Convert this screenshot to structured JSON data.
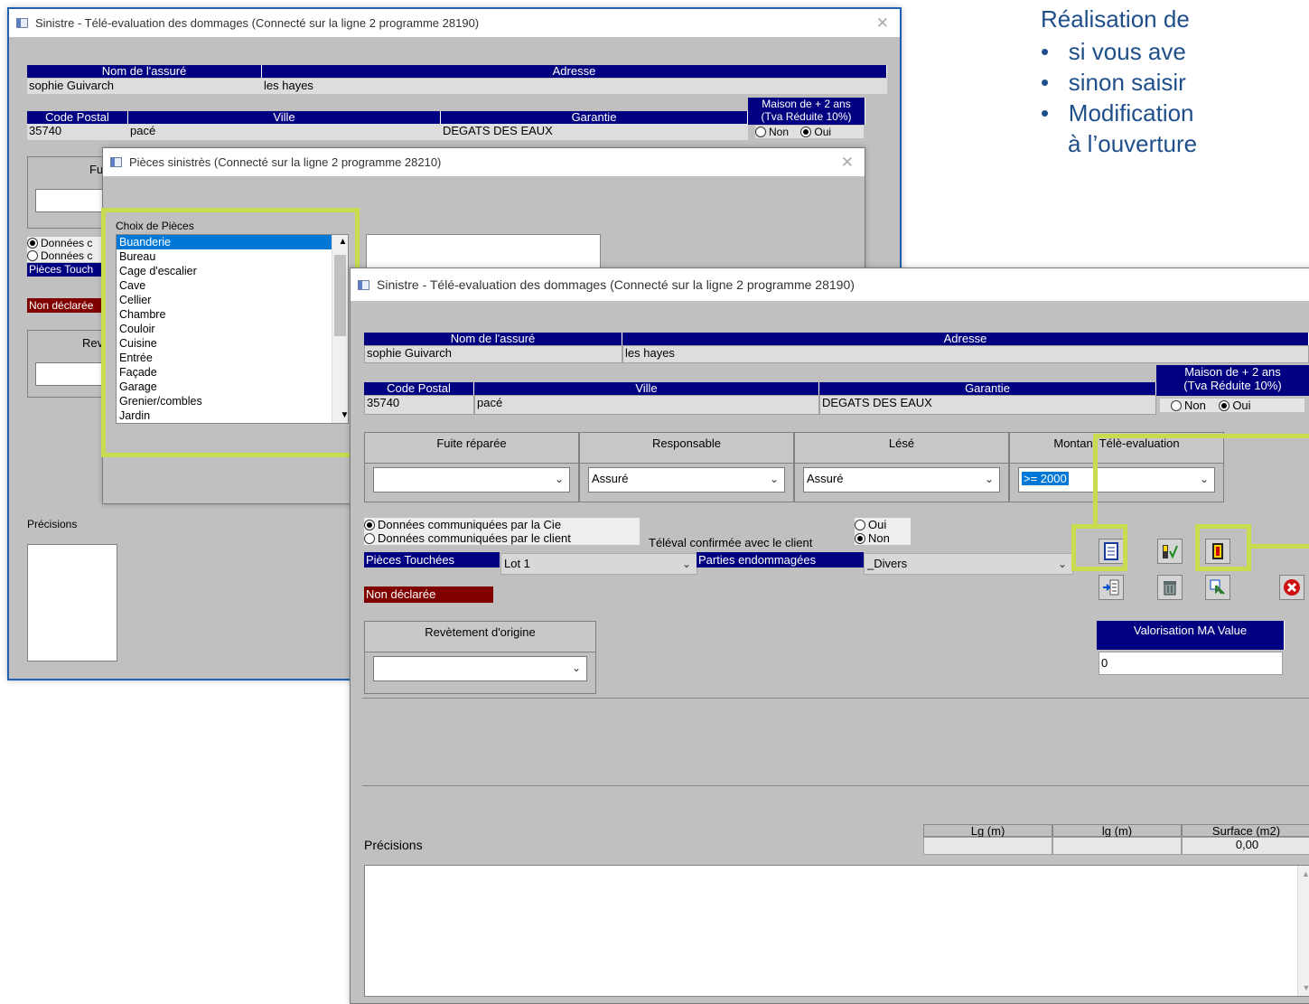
{
  "slide": {
    "heading": "Réalisation de",
    "bullets": [
      "si vous ave",
      "sinon saisir",
      "Modification",
      "à l’ouverture"
    ]
  },
  "back_window": {
    "title": "Sinistre - Télé-evaluation des dommages (Connecté sur la ligne 2 programme 28190)",
    "labels": {
      "nom": "Nom de l'assuré",
      "adresse": "Adresse",
      "maison": "Maison de + 2 ans",
      "tva": "(Tva Réduite 10%)",
      "code_postal": "Code Postal",
      "ville": "Ville",
      "garantie": "Garantie",
      "non": "Non",
      "oui": "Oui",
      "fu": "Fu",
      "donnees1": "Données c",
      "donnees2": "Données c",
      "pieces": "Pièces Touch",
      "non_declaree": "Non déclarée",
      "rev": "Rev",
      "precisions": "Précisions"
    },
    "values": {
      "nom": "sophie Guivarch",
      "adresse": "les hayes",
      "code_postal": "35740",
      "ville": "pacé",
      "garantie": "DEGATS DES EAUX"
    }
  },
  "pieces_dialog": {
    "title": "Pièces sinistrès (Connecté sur la ligne 2 programme 28210)",
    "choix_label": "Choix de Pièces",
    "items": [
      "Buanderie",
      "Bureau",
      "Cage d'escalier",
      "Cave",
      "Cellier",
      "Chambre",
      "Couloir",
      "Cuisine",
      "Entrée",
      "Façade",
      "Garage",
      "Grenier/combles",
      "Jardin"
    ],
    "selected": "Buanderie"
  },
  "front_window": {
    "title": "Sinistre - Télé-evaluation des dommages (Connecté sur la ligne 2 programme 28190)",
    "labels": {
      "nom": "Nom de l'assuré",
      "adresse": "Adresse",
      "maison": "Maison de + 2 ans",
      "tva": "(Tva Réduite 10%)",
      "code_postal": "Code Postal",
      "ville": "Ville",
      "garantie": "Garantie",
      "non": "Non",
      "oui": "Oui",
      "fuite": "Fuite réparée",
      "responsable": "Responsable",
      "lese": "Lésé",
      "montant": "Montant Télè-evaluation",
      "donnees_cie": "Données communiquées par la Cie",
      "donnees_client": "Données communiquées par le client",
      "televal": "Téléval confirmée avec le client",
      "televal_oui": "Oui",
      "televal_non": "Non",
      "pieces": "Pièces Touchées",
      "parties": "Parties endommagées",
      "non_declaree": "Non déclarée",
      "revetement": "Revètement d'origine",
      "valorisation": "Valorisation MA Value",
      "lg": "Lg (m)",
      "lg2": "lg (m)",
      "surface": "Surface (m2)",
      "precisions": "Précisions"
    },
    "values": {
      "nom": "sophie Guivarch",
      "adresse": "les hayes",
      "code_postal": "35740",
      "ville": "pacé",
      "garantie": "DEGATS DES EAUX",
      "fuite": "",
      "responsable": "Assuré",
      "lese": "Assuré",
      "montant": ">= 2000",
      "pieces": "Lot 1",
      "parties": "_Divers",
      "valorisation": "0",
      "surface": "0,00"
    }
  },
  "colors": {
    "accent_header": "#000080",
    "highlight": "#c9dc4f",
    "slide_text": "#1f4f8a",
    "non_declaree": "#800000"
  }
}
